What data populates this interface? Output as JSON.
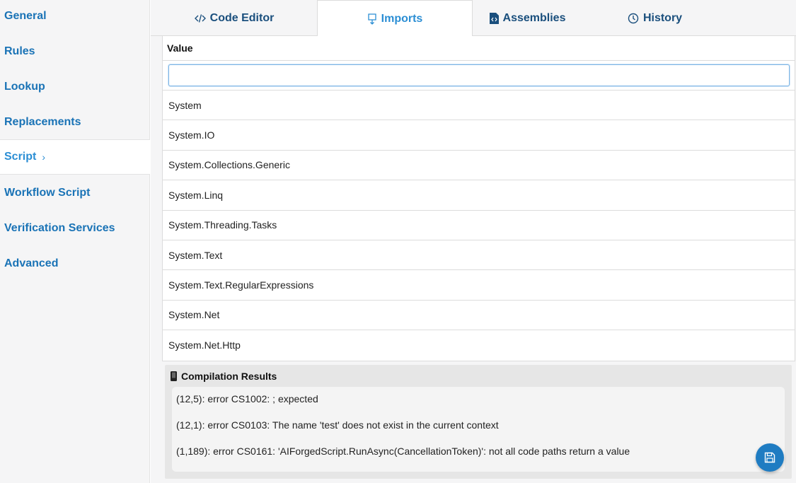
{
  "sidebar": {
    "items": [
      {
        "label": "General"
      },
      {
        "label": "Rules"
      },
      {
        "label": "Lookup"
      },
      {
        "label": "Replacements"
      },
      {
        "label": "Script",
        "active": true
      },
      {
        "label": "Workflow Script"
      },
      {
        "label": "Verification Services"
      },
      {
        "label": "Advanced"
      }
    ],
    "active_chevron": "›"
  },
  "tabs": [
    {
      "label": "Code Editor",
      "icon": "code-icon"
    },
    {
      "label": "Imports",
      "icon": "import-icon",
      "active": true
    },
    {
      "label": "Assemblies",
      "icon": "file-code-icon"
    },
    {
      "label": "History",
      "icon": "history-icon"
    }
  ],
  "imports": {
    "column_header": "Value",
    "filter_value": "",
    "rows": [
      "System",
      "System.IO",
      "System.Collections.Generic",
      "System.Linq",
      "System.Threading.Tasks",
      "System.Text",
      "System.Text.RegularExpressions",
      "System.Net",
      "System.Net.Http"
    ]
  },
  "compilation": {
    "title": "Compilation Results",
    "errors": [
      "(12,5): error CS1002: ; expected",
      "(12,1): error CS0103: The name 'test' does not exist in the current context",
      "(1,189): error CS0161: 'AIForgedScript.RunAsync(CancellationToken)': not all code paths return a value"
    ]
  },
  "colors": {
    "accent": "#2b8ed4",
    "nav_text": "#1a73b6",
    "fab": "#1f7cc2"
  }
}
